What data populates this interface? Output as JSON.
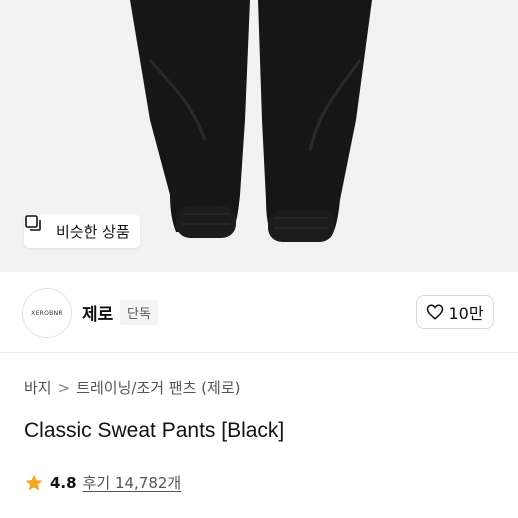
{
  "hero": {
    "similar_button": {
      "label": "비슷한 상품",
      "icon": "similar-items-icon"
    }
  },
  "brand": {
    "logo_text": "XEROBNR",
    "name": "제로",
    "badge": "단독",
    "like_button": {
      "icon": "heart-icon",
      "count": "10만"
    }
  },
  "breadcrumb": {
    "items": [
      "바지",
      "트레이닝/조거 팬츠 (제로)"
    ],
    "separator": ">"
  },
  "product": {
    "title": "Classic Sweat Pants [Black]"
  },
  "rating": {
    "star_icon": "star-icon",
    "star_color": "#f5a623",
    "value": "4.8",
    "reviews": "후기 14,782개"
  },
  "colors": {
    "hero_bg": "#f2f2f2",
    "pants": "#161616"
  }
}
